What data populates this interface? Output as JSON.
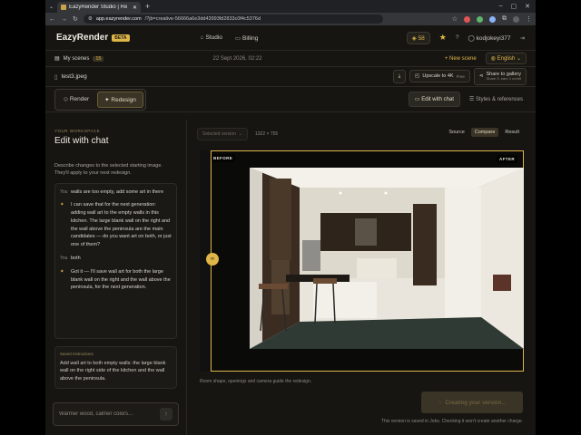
{
  "browser": {
    "tab_title": "EazyRender Studio | Re",
    "url_host": "app.eazyrender.com",
    "url_path": "/?jb=creative-56666a6e3dd43993fd2833c0f4c5376d"
  },
  "app": {
    "logo": "EazyRender",
    "beta_label": "BETA",
    "nav": [
      {
        "label": "Studio",
        "icon": "home-icon"
      },
      {
        "label": "Billing",
        "icon": "card-icon"
      }
    ],
    "credits": "58",
    "username": "kodjokeyi377"
  },
  "subbar": {
    "my_scenes_label": "My scenes",
    "my_scenes_count": "15",
    "date": "22 Sept 2026, 02:22",
    "new_scene_label": "+ New scene",
    "language": "English"
  },
  "filebar": {
    "filename": "test3.jpeg",
    "upscale_label": "Upscale to 4K",
    "upscale_badge": "Free",
    "share_label": "Share to gallery",
    "share_sub": "Share 3, earn 1 credit"
  },
  "modes": {
    "render_label": "Render",
    "redesign_label": "Redesign",
    "edit_chat_label": "Edit with chat",
    "styles_label": "Styles & references"
  },
  "left": {
    "kicker": "YOUR WORKSPACE",
    "title": "Edit with chat",
    "description": "Describe changes to the selected starting image. They'll apply to your next redesign.",
    "messages": [
      {
        "role": "You",
        "text": "walls are too empty, add some art in there"
      },
      {
        "role": "ai",
        "text": "I can save that for the next generation: adding wall art to the empty walls in this kitchen. The large blank wall on the right and the wall above the peninsula are the main candidates — do you want art on both, or just one of them?"
      },
      {
        "role": "You",
        "text": "both"
      },
      {
        "role": "ai",
        "text": "Got it — I'll save wall art for both the large blank wall on the right and the wall above the peninsula, for the next generation."
      }
    ],
    "saved_heading": "Saved instructions",
    "saved_text": "Add wall art to both empty walls: the large blank wall on the right side of the kitchen and the wall above the peninsula.",
    "input_placeholder": "Warmer wood, calmer colors..."
  },
  "right": {
    "version_placeholder": "Selected version",
    "dimensions": "1322 × 755",
    "view_tabs": [
      "Source",
      "Compare",
      "Result"
    ],
    "active_view": "Compare",
    "before_label": "BEFORE",
    "after_label": "AFTER",
    "caption": "Room shape, openings and camera guide the redesign.",
    "create_label": "Creating your version...",
    "footnote": "This version is saved in Jobs. Checking it won't create another charge."
  },
  "colors": {
    "accent": "#e0b648",
    "bg": "#161512"
  }
}
